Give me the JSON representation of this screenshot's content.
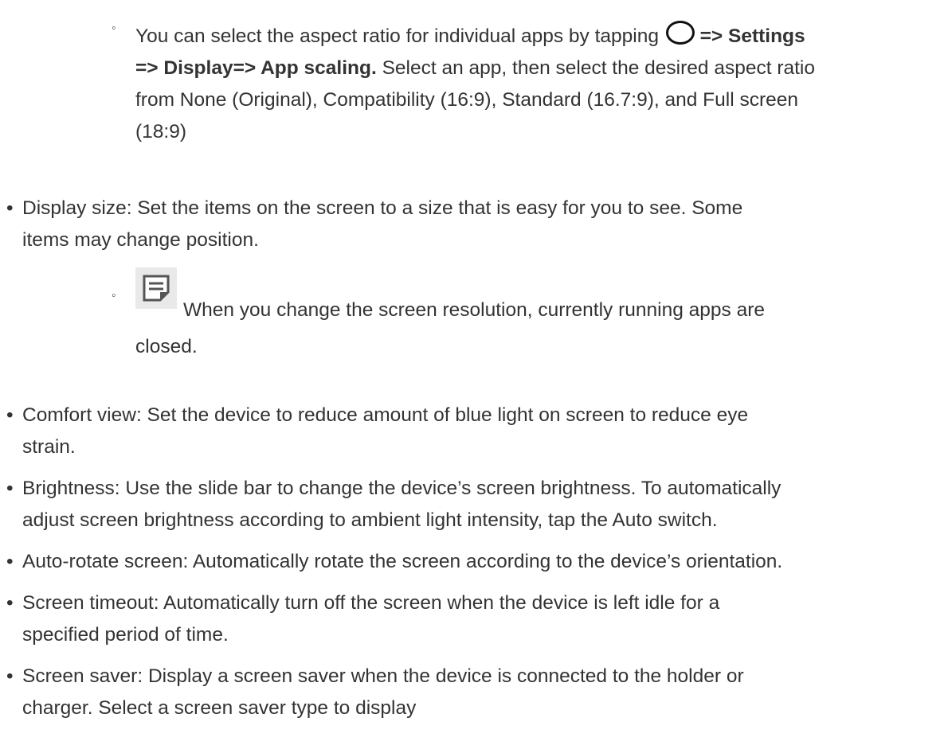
{
  "sub1": {
    "marker": "◦",
    "text_before": "You can select the aspect ratio for individual apps by tapping",
    "icon": "circle-home-icon",
    "bold_path": "=> Settings => Display=> App scaling.",
    "line2_tail": "Select an app, then select the desired aspect ratio",
    "line3": "from None (Original), Compatibility (16:9), Standard (16.7:9), and Full screen",
    "line4": "(18:9)"
  },
  "display_size": {
    "bullet": "•",
    "line1": "Display size: Set the items on the screen to a size that is easy for you to see. Some",
    "line2": "items may change position."
  },
  "note": {
    "marker": "◦",
    "icon": "note-icon",
    "line1": "When you change the screen resolution, currently running apps are",
    "line2": "closed."
  },
  "items": [
    {
      "bullet": "•",
      "line1": "Comfort view: Set the device to reduce amount of blue light on screen to reduce eye",
      "line2": "strain."
    },
    {
      "bullet": "•",
      "line1": "Brightness: Use the slide bar to change the device’s screen brightness. To automatically",
      "line2": "adjust screen brightness according to ambient light intensity, tap the Auto switch."
    },
    {
      "bullet": "•",
      "line1": "Auto-rotate screen: Automatically rotate the screen according to the device’s orientation.",
      "line2": ""
    },
    {
      "bullet": "•",
      "line1": "Screen timeout: Automatically turn off the screen when the device is left idle for a",
      "line2": "specified period of time."
    },
    {
      "bullet": "•",
      "line1": "Screen saver: Display a screen saver when the device is connected to the holder or",
      "line2": "charger. Select a screen saver type to display"
    }
  ]
}
